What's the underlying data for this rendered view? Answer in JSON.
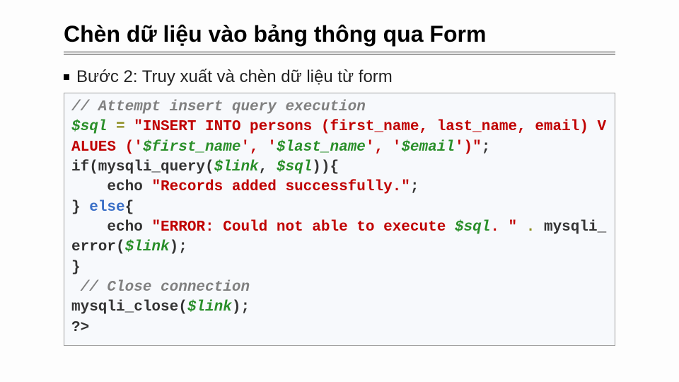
{
  "title": "Chèn dữ liệu vào bảng thông qua Form",
  "bullet": "Bước 2: Truy xuất và chèn dữ liệu từ form",
  "code": {
    "c1": "// Attempt insert query execution",
    "v_sql": "$sql",
    "eq": " = ",
    "s1a": "\"INSERT INTO persons (first_name, last_name, email) VALUES ('",
    "v_fn": "$first_name",
    "s1b": "', '",
    "v_ln": "$last_name",
    "s1c": "', '",
    "v_em": "$email",
    "s1d": "')\"",
    "semi": ";",
    "if1": "if(mysqli_query(",
    "v_link": "$link",
    "comma_sp": ", ",
    "if2": ")){",
    "echo1a": "    echo ",
    "s2": "\"Records added successfully.\"",
    "close_brace": "} ",
    "else_kw": "else",
    "open_brace": "{",
    "echo2a": "    echo ",
    "s3a": "\"ERROR: Could not able to execute ",
    "s3b": ". \"",
    "dot": " . ",
    "mer": "mysqli_error(",
    "cp": ");",
    "brace_end": "}",
    "c2": " // Close connection",
    "mclose": "mysqli_close(",
    "qend": "?>"
  }
}
